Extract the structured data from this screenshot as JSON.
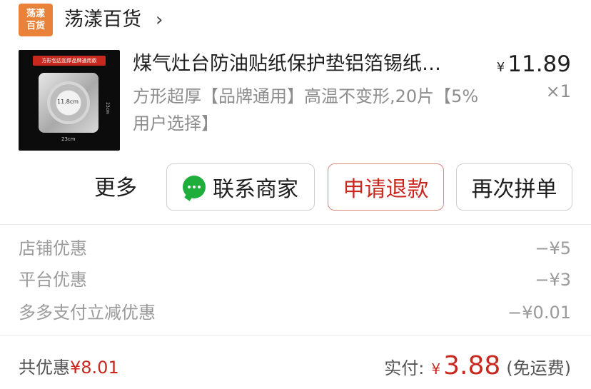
{
  "store": {
    "logo_line1": "荡漾",
    "logo_line2": "百货",
    "name": "荡漾百货",
    "chevron": "›"
  },
  "product": {
    "thumb_banner": "方形包边加厚品牌通用款",
    "thumb_size_label": "11.8cm",
    "thumb_side_label": "23cm",
    "thumb_bottom_label": "23cm",
    "title": "煤气灶台防油贴纸保护垫铝箔锡纸…",
    "spec": "方形超厚【品牌通用】高温不变形,20片【5%用户选择】",
    "price_symbol": "¥",
    "price": "11.89",
    "quantity": "×1"
  },
  "actions": {
    "more": "更多",
    "contact": "联系商家",
    "refund": "申请退款",
    "reorder": "再次拼单",
    "chat_icon": "chat-bubble-icon"
  },
  "discounts": [
    {
      "label": "店铺优惠",
      "value": "−¥5"
    },
    {
      "label": "平台优惠",
      "value": "−¥3"
    },
    {
      "label": "多多支付立减优惠",
      "value": "−¥0.01"
    }
  ],
  "footer": {
    "total_label": "共优惠",
    "total_value": "¥8.01",
    "paid_label": "实付:",
    "paid_symbol": "¥",
    "paid_amount": "3.88",
    "paid_note": "(免运费)"
  },
  "colors": {
    "accent_red": "#c8281e",
    "logo_orange": "#e8823a",
    "wechat_green": "#1fad3c"
  }
}
